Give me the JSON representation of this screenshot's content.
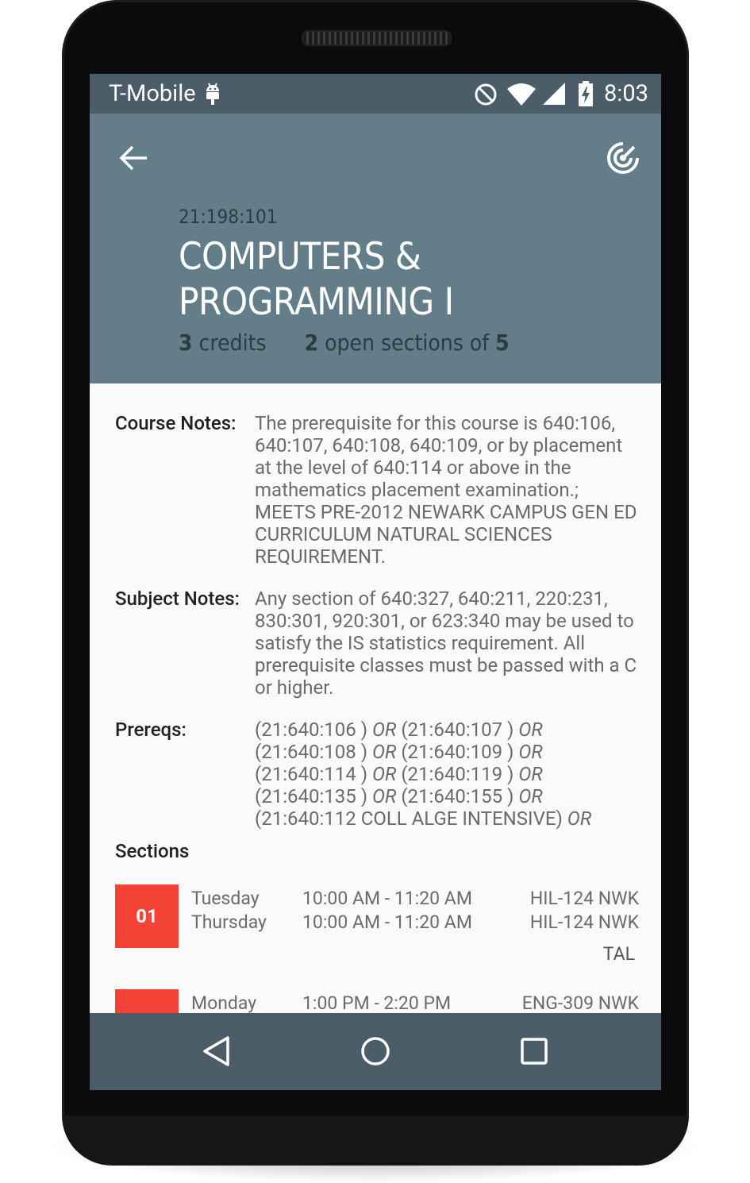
{
  "status_bar": {
    "carrier": "T-Mobile",
    "time": "8:03",
    "icons": [
      "android-icon",
      "do-not-disturb-icon",
      "wifi-icon",
      "cell-signal-icon",
      "battery-charging-icon"
    ]
  },
  "header": {
    "back_icon": "arrow-back-icon",
    "track_icon": "radar-track-icon",
    "course_code": "21:198:101",
    "title": "COMPUTERS & PROGRAMMING I",
    "credits_value": "3",
    "credits_label": "credits",
    "open_sections_value": "2",
    "open_sections_label": "open sections of",
    "total_sections_value": "5"
  },
  "notes": {
    "course_notes_label": "Course Notes:",
    "course_notes_text": "The prerequisite for this course is 640:106, 640:107, 640:108, 640:109, or by placement at the level of 640:114 or above in the mathematics placement examination.; MEETS PRE-2012 NEWARK CAMPUS GEN ED CURRICULUM NATURAL SCIENCES REQUIREMENT.",
    "subject_notes_label": "Subject Notes:",
    "subject_notes_text": "Any section of 640:327, 640:211, 220:231, 830:301, 920:301, or 623:340 may be used to satisfy the IS statistics requirement. All prerequisite classes must be passed with a C or higher.",
    "prereqs_label": "Prereqs:",
    "prereqs_lines": [
      {
        "a": "(21:640:106 )",
        "op1": "OR",
        "b": "(21:640:107 )",
        "op2": "OR"
      },
      {
        "a": "(21:640:108 )",
        "op1": "OR",
        "b": "(21:640:109 )",
        "op2": "OR"
      },
      {
        "a": "(21:640:114 )",
        "op1": "OR",
        "b": "(21:640:119 )",
        "op2": "OR"
      },
      {
        "a": "(21:640:135 )",
        "op1": "OR",
        "b": "(21:640:155 )",
        "op2": "OR"
      },
      {
        "a": "(21:640:112 COLL ALGE INTENSIVE)",
        "op1": "OR",
        "b": "",
        "op2": ""
      }
    ]
  },
  "sections": {
    "heading": "Sections",
    "items": [
      {
        "number": "01",
        "color": "#f44336",
        "meetings": [
          {
            "day": "Tuesday",
            "time": "10:00 AM - 11:20 AM",
            "room": "HIL-124 NWK"
          },
          {
            "day": "Thursday",
            "time": "10:00 AM - 11:20 AM",
            "room": "HIL-124 NWK"
          }
        ],
        "instructor": "TAL"
      },
      {
        "number": "",
        "color": "#f44336",
        "meetings": [
          {
            "day": "Monday",
            "time": "1:00 PM - 2:20 PM",
            "room": "ENG-309 NWK"
          }
        ],
        "instructor": ""
      }
    ]
  },
  "nav_bar": {
    "buttons": [
      "back-triangle-icon",
      "home-circle-icon",
      "recents-square-icon"
    ]
  },
  "colors": {
    "status_bar": "#4a5d68",
    "header": "#637d89",
    "section_badge": "#f44336",
    "nav_bar": "#4a5d68"
  }
}
